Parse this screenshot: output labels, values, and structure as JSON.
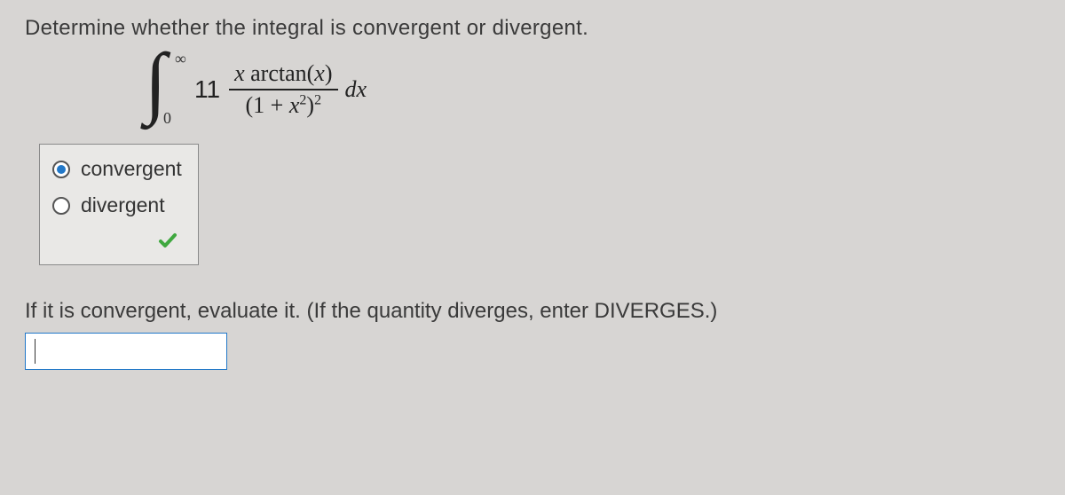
{
  "question": "Determine whether the integral is convergent or divergent.",
  "integral": {
    "lowerBound": "0",
    "upperBound": "∞",
    "coefficient": "11",
    "numerator_x": "x",
    "numerator_fn": "arctan(",
    "numerator_arg": "x",
    "numerator_close": ")",
    "denominator": "(1 + x²)²",
    "differential": "dx"
  },
  "options": {
    "opt1": "convergent",
    "opt2": "divergent"
  },
  "selected": "opt1",
  "followup": "If it is convergent, evaluate it. (If the quantity diverges, enter DIVERGES.)",
  "inputValue": ""
}
